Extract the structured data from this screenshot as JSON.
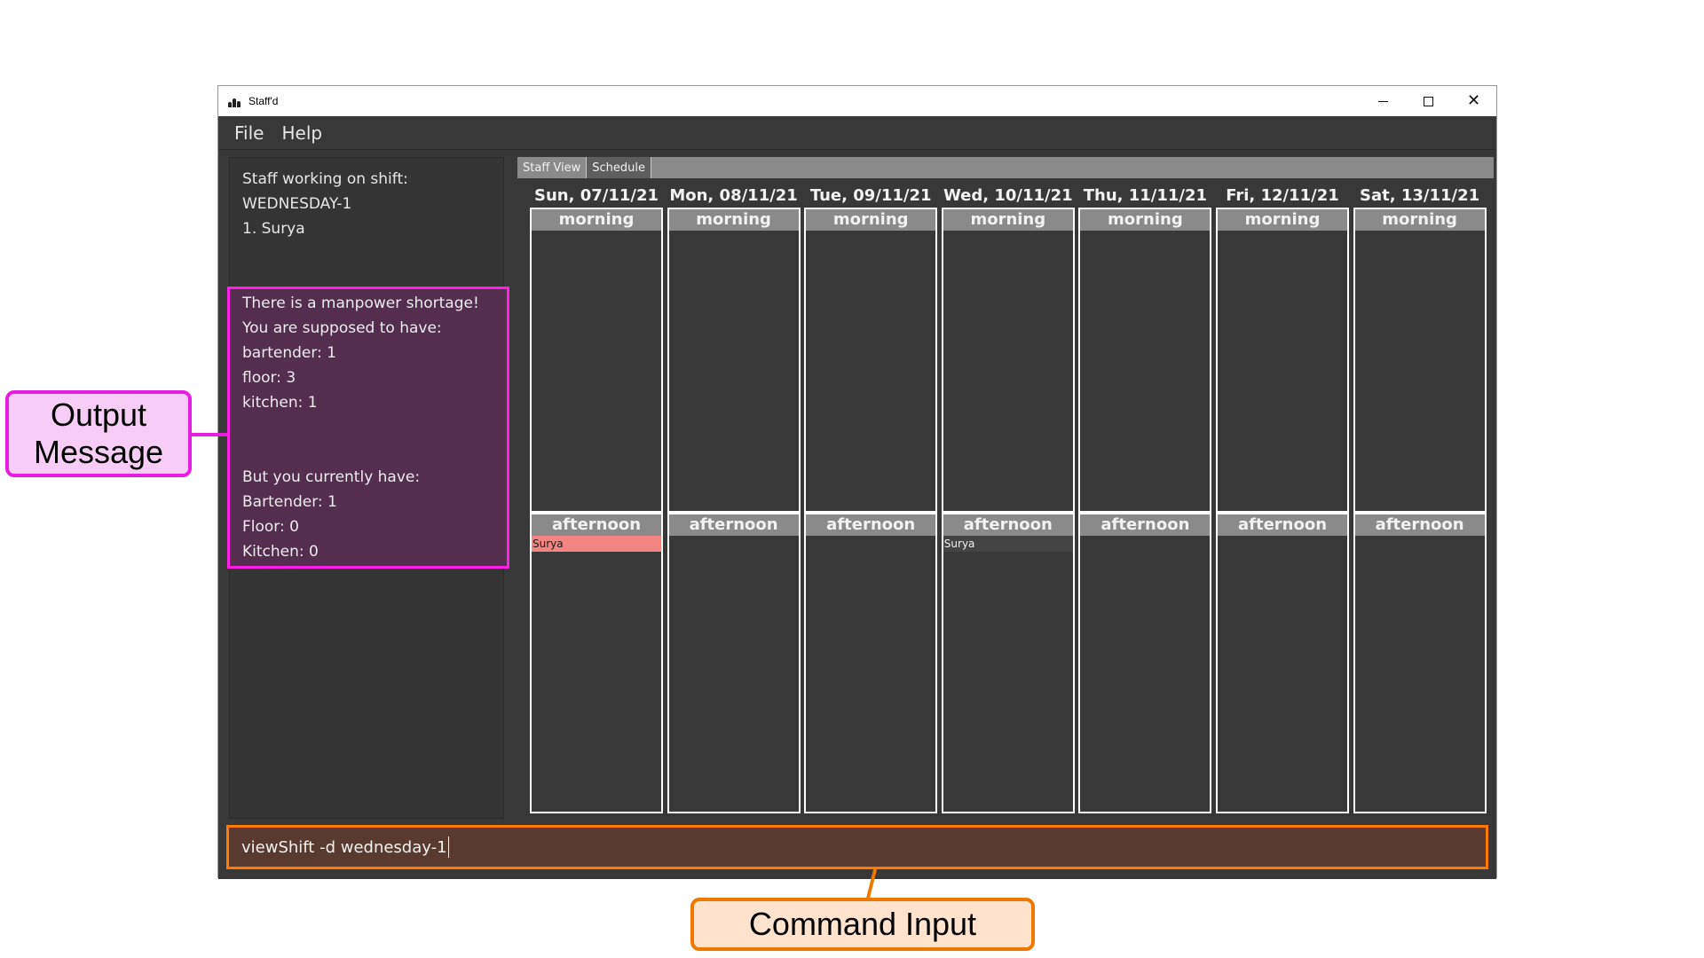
{
  "window": {
    "title": "Staff'd",
    "controls": {
      "minimize": "minimize",
      "maximize": "maximize",
      "close": "✕"
    }
  },
  "menu": [
    {
      "label": "File"
    },
    {
      "label": "Help"
    }
  ],
  "shift_info": {
    "heading": "Staff working on shift:",
    "shift": "WEDNESDAY-1",
    "staff": [
      "1. Surya"
    ]
  },
  "output_message": {
    "lines": [
      "There is a manpower shortage!",
      "You are supposed to have:",
      "bartender: 1",
      "floor: 3",
      "kitchen: 1",
      "",
      "",
      "But you currently have:",
      "Bartender: 1",
      "Floor: 0",
      "Kitchen: 0"
    ]
  },
  "tabs": [
    {
      "label": "Staff View",
      "active": false
    },
    {
      "label": "Schedule",
      "active": true
    }
  ],
  "schedule": {
    "slot_labels": {
      "morning": "morning",
      "afternoon": "afternoon"
    },
    "days": [
      {
        "date": "Sun, 07/11/21",
        "morning": [],
        "afternoon": [
          {
            "name": "Surya",
            "shortage": true
          }
        ]
      },
      {
        "date": "Mon, 08/11/21",
        "morning": [],
        "afternoon": []
      },
      {
        "date": "Tue, 09/11/21",
        "morning": [],
        "afternoon": []
      },
      {
        "date": "Wed, 10/11/21",
        "morning": [],
        "afternoon": [
          {
            "name": "Surya",
            "shortage": false
          }
        ]
      },
      {
        "date": "Thu, 11/11/21",
        "morning": [],
        "afternoon": []
      },
      {
        "date": "Fri, 12/11/21",
        "morning": [],
        "afternoon": []
      },
      {
        "date": "Sat, 13/11/21",
        "morning": [],
        "afternoon": []
      }
    ],
    "colors": {
      "shortage": "#f28482",
      "normal": "#444444"
    }
  },
  "command": {
    "value": "viewShift -d wednesday-1"
  },
  "annotations": {
    "output_label_line1": "Output",
    "output_label_line2": "Message",
    "command_label": "Command Input",
    "output_color": "#e61ee0",
    "command_color": "#f07800"
  }
}
